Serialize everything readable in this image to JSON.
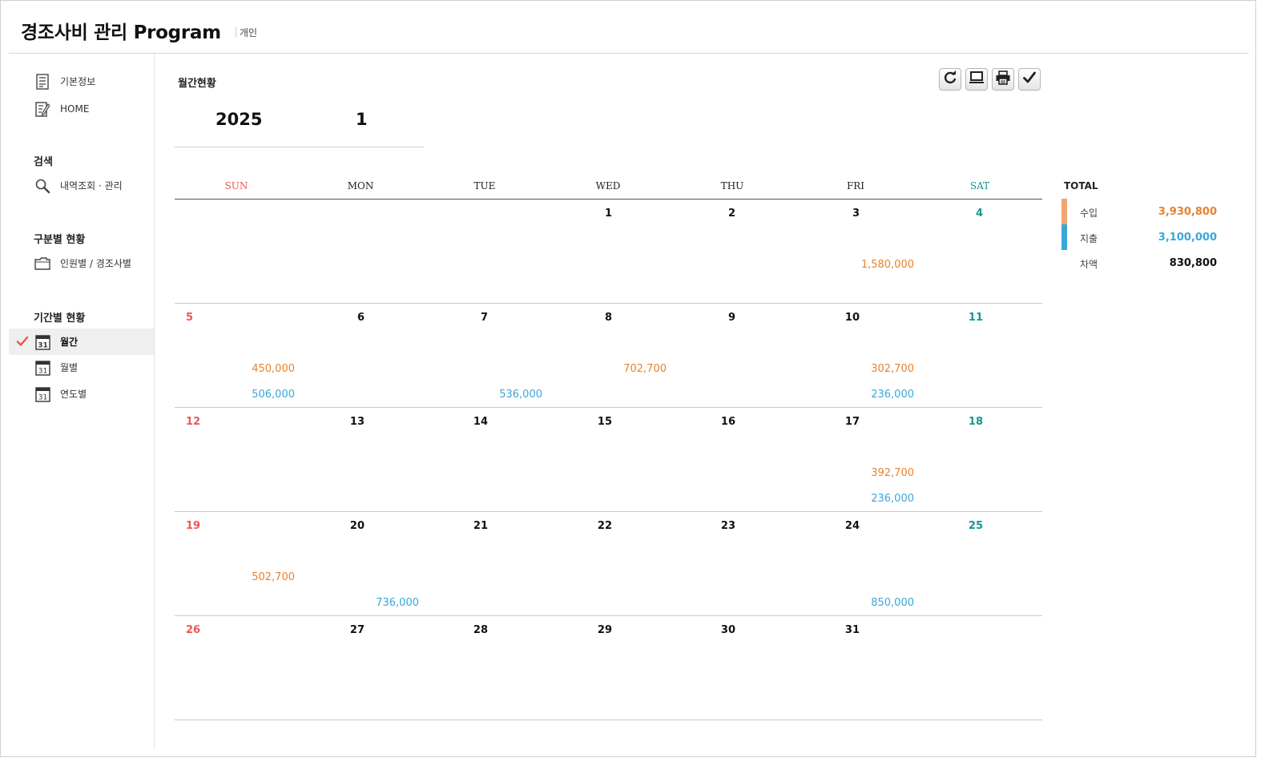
{
  "app": {
    "title": "경조사비 관리 Program",
    "subtitle": "개인"
  },
  "sidebar": {
    "top_items": [
      {
        "label": "기본정보",
        "icon": "document-icon"
      },
      {
        "label": "HOME",
        "icon": "edit-document-icon"
      }
    ],
    "sections": [
      {
        "title": "검색",
        "items": [
          {
            "label": "내역조회 · 관리",
            "icon": "search-icon"
          }
        ]
      },
      {
        "title": "구분별 현황",
        "items": [
          {
            "label": "인원별 / 경조사별",
            "icon": "folder-icon"
          }
        ]
      },
      {
        "title": "기간별 현황",
        "items": [
          {
            "label": "월간",
            "icon": "calendar-icon",
            "active": true
          },
          {
            "label": "월별",
            "icon": "calendar-icon"
          },
          {
            "label": "연도별",
            "icon": "calendar-icon"
          }
        ]
      }
    ],
    "calendar_icon_text": "31",
    "active_marker_icon": "checkmark-icon"
  },
  "main": {
    "title": "월간현황",
    "year": "2025",
    "month": "1",
    "toolbar": [
      {
        "name": "refresh-button",
        "icon": "refresh-icon"
      },
      {
        "name": "display-button",
        "icon": "monitor-icon"
      },
      {
        "name": "print-button",
        "icon": "printer-icon"
      },
      {
        "name": "confirm-button",
        "icon": "checkmark-icon"
      }
    ]
  },
  "calendar": {
    "weekdays": [
      "SUN",
      "MON",
      "TUE",
      "WED",
      "THU",
      "FRI",
      "SAT"
    ],
    "weeks": [
      [
        {
          "day": ""
        },
        {
          "day": ""
        },
        {
          "day": ""
        },
        {
          "day": "1"
        },
        {
          "day": "2"
        },
        {
          "day": "3",
          "income": "1,580,000"
        },
        {
          "day": "4"
        }
      ],
      [
        {
          "day": "5",
          "income": "450,000",
          "expense": "506,000"
        },
        {
          "day": "6"
        },
        {
          "day": "7",
          "expense": "536,000"
        },
        {
          "day": "8",
          "income": "702,700"
        },
        {
          "day": "9"
        },
        {
          "day": "10",
          "income": "302,700",
          "expense": "236,000"
        },
        {
          "day": "11"
        }
      ],
      [
        {
          "day": "12"
        },
        {
          "day": "13"
        },
        {
          "day": "14"
        },
        {
          "day": "15"
        },
        {
          "day": "16"
        },
        {
          "day": "17",
          "income": "392,700",
          "expense": "236,000"
        },
        {
          "day": "18"
        }
      ],
      [
        {
          "day": "19",
          "income": "502,700"
        },
        {
          "day": "20",
          "expense": "736,000"
        },
        {
          "day": "21"
        },
        {
          "day": "22"
        },
        {
          "day": "23"
        },
        {
          "day": "24",
          "expense": "850,000"
        },
        {
          "day": "25"
        }
      ],
      [
        {
          "day": "26"
        },
        {
          "day": "27"
        },
        {
          "day": "28"
        },
        {
          "day": "29"
        },
        {
          "day": "30"
        },
        {
          "day": "31"
        },
        {
          "day": ""
        }
      ]
    ]
  },
  "totals": {
    "title": "TOTAL",
    "rows": [
      {
        "label": "수입",
        "value": "3,930,800",
        "color": "#e8822b",
        "bar_color": "#f0a66e"
      },
      {
        "label": "지출",
        "value": "3,100,000",
        "color": "#3aa6db",
        "bar_color": "#3aa6db"
      },
      {
        "label": "차액",
        "value": "830,800",
        "color": "#111111",
        "bar_color": ""
      }
    ]
  },
  "colors": {
    "income": "#e8822b",
    "expense": "#3aa6db",
    "sunday": "#ee5555",
    "saturday": "#11998e",
    "active_check": "#ee5555"
  }
}
